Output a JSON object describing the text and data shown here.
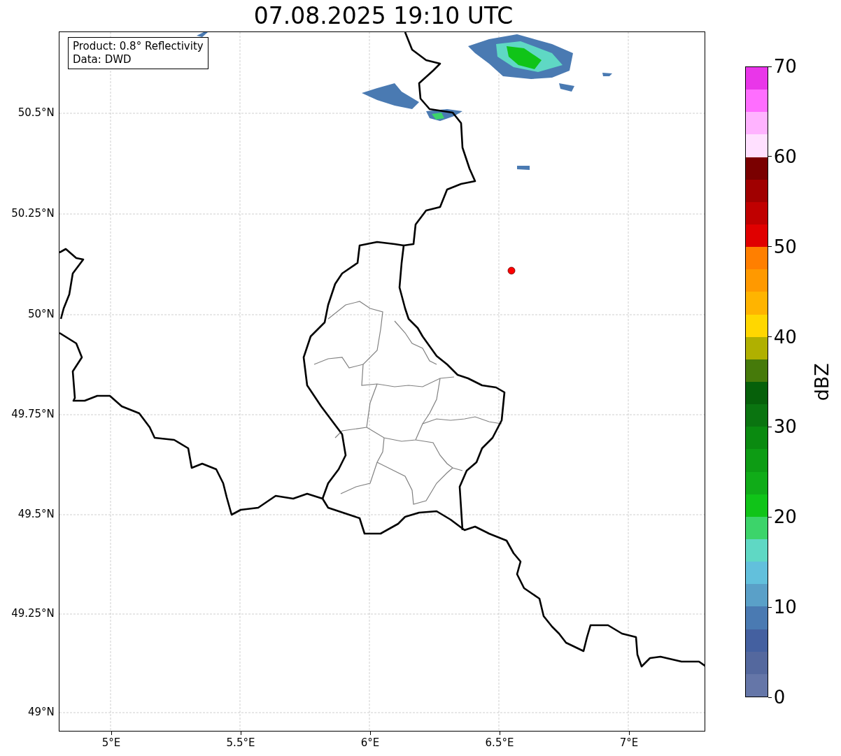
{
  "title": "07.08.2025 19:10 UTC",
  "legend": {
    "lines": [
      "Product: 0.8° Reflectivity",
      "Data: DWD"
    ]
  },
  "map": {
    "lat_labels": [
      "50.5°N",
      "50.25°N",
      "50°N",
      "49.75°N",
      "49.5°N",
      "49.25°N",
      "49°N"
    ],
    "lon_labels": [
      "5°E",
      "5.5°E",
      "6°E",
      "6.5°E",
      "7°E"
    ]
  },
  "colorbar": {
    "label": "dBZ",
    "tick_labels": [
      "70",
      "60",
      "50",
      "40",
      "30",
      "20",
      "10",
      "0"
    ],
    "segments": [
      {
        "color": "#6576a8"
      },
      {
        "color": "#54689e"
      },
      {
        "color": "#4460a0"
      },
      {
        "color": "#4a7ab2"
      },
      {
        "color": "#5aa0c8"
      },
      {
        "color": "#62c0dc"
      },
      {
        "color": "#5fd8c4"
      },
      {
        "color": "#3cd46a"
      },
      {
        "color": "#10c418"
      },
      {
        "color": "#10ac18"
      },
      {
        "color": "#0d9c14"
      },
      {
        "color": "#0a8a10"
      },
      {
        "color": "#0a7410"
      },
      {
        "color": "#06600a"
      },
      {
        "color": "#467a0a"
      },
      {
        "color": "#b0b000"
      },
      {
        "color": "#ffd700"
      },
      {
        "color": "#ffb400"
      },
      {
        "color": "#ff9900"
      },
      {
        "color": "#ff7f00"
      },
      {
        "color": "#e00000"
      },
      {
        "color": "#c00000"
      },
      {
        "color": "#a00000"
      },
      {
        "color": "#7a0000"
      },
      {
        "color": "#ffe0ff"
      },
      {
        "color": "#ffb3ff"
      },
      {
        "color": "#ff6eff"
      },
      {
        "color": "#e936e9"
      }
    ]
  }
}
